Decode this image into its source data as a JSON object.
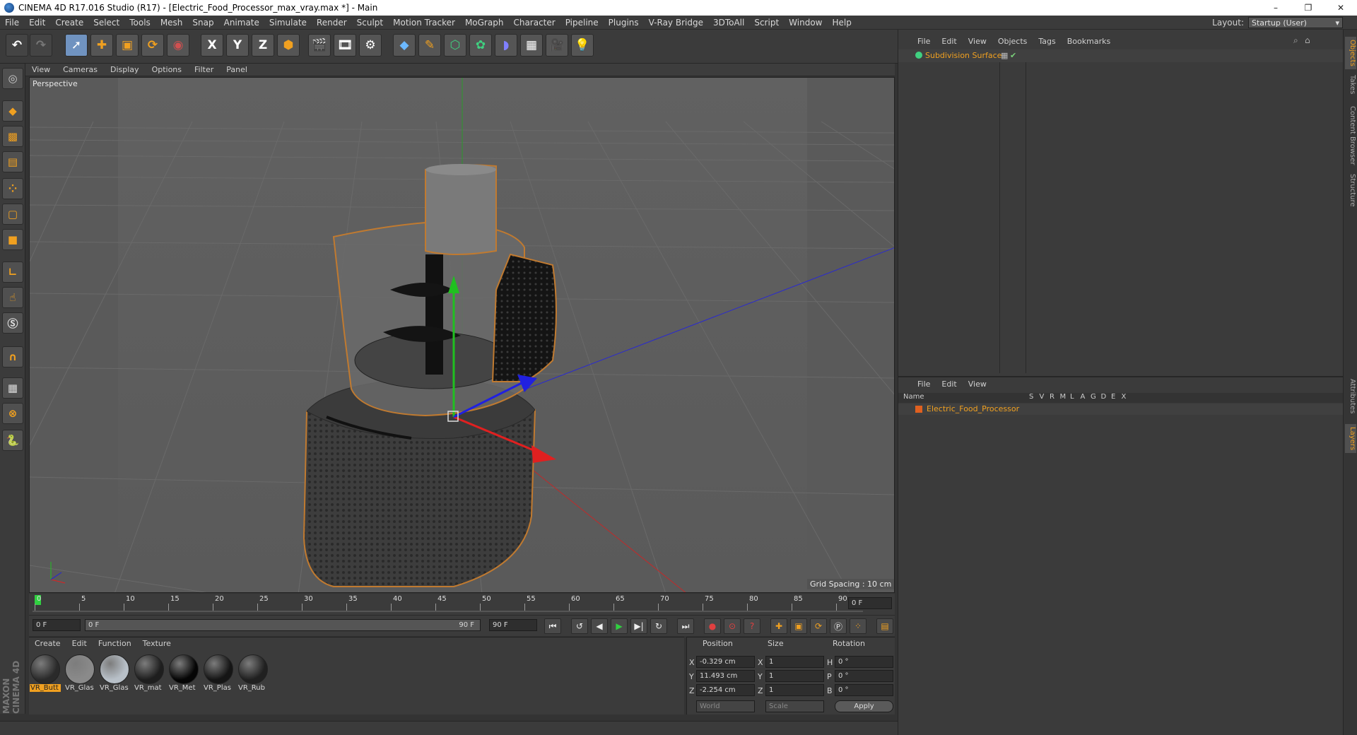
{
  "window": {
    "title": "CINEMA 4D R17.016 Studio (R17) - [Electric_Food_Processor_max_vray.max *] - Main",
    "controls": [
      "–",
      "❐",
      "✕"
    ]
  },
  "menubar": {
    "items": [
      "File",
      "Edit",
      "Create",
      "Select",
      "Tools",
      "Mesh",
      "Snap",
      "Animate",
      "Simulate",
      "Render",
      "Sculpt",
      "Motion Tracker",
      "MoGraph",
      "Character",
      "Pipeline",
      "Plugins",
      "V-Ray Bridge",
      "3DToAll",
      "Script",
      "Window",
      "Help"
    ],
    "layout_label": "Layout:",
    "layout_value": "Startup (User)"
  },
  "toolbar": {
    "axis_x": "X",
    "axis_y": "Y",
    "axis_z": "Z"
  },
  "viewport": {
    "menu": [
      "View",
      "Cameras",
      "Display",
      "Options",
      "Filter",
      "Panel"
    ],
    "label": "Perspective",
    "grid_spacing": "Grid Spacing : 10 cm"
  },
  "timeline": {
    "ticks": [
      "0",
      "5",
      "10",
      "15",
      "20",
      "25",
      "30",
      "35",
      "40",
      "45",
      "50",
      "55",
      "60",
      "65",
      "70",
      "75",
      "80",
      "85",
      "90"
    ],
    "current_frame": "0 F",
    "start_field": "0 F",
    "range_start": "0 F",
    "range_end": "90 F",
    "end_field": "90 F"
  },
  "material_manager": {
    "menu": [
      "Create",
      "Edit",
      "Function",
      "Texture"
    ],
    "materials": [
      {
        "name": "VR_Butt",
        "color": "#2a2a2a"
      },
      {
        "name": "VR_Glas",
        "color": "#8a8a8a"
      },
      {
        "name": "VR_Glas",
        "color": "#b8c0c8"
      },
      {
        "name": "VR_mat",
        "color": "#1e1e1e"
      },
      {
        "name": "VR_Met",
        "color": "#050505"
      },
      {
        "name": "VR_Plas",
        "color": "#151515"
      },
      {
        "name": "VR_Rub",
        "color": "#202020"
      }
    ]
  },
  "coordinates": {
    "headers": {
      "position": "Position",
      "size": "Size",
      "rotation": "Rotation"
    },
    "rows": [
      {
        "axis": "X",
        "pos": "-0.329 cm",
        "size_axis": "X",
        "size": "1",
        "rot_axis": "H",
        "rot": "0 °"
      },
      {
        "axis": "Y",
        "pos": "11.493 cm",
        "size_axis": "Y",
        "size": "1",
        "rot_axis": "P",
        "rot": "0 °"
      },
      {
        "axis": "Z",
        "pos": "-2.254 cm",
        "size_axis": "Z",
        "size": "1",
        "rot_axis": "B",
        "rot": "0 °"
      }
    ],
    "mode": "World",
    "size_mode": "Scale",
    "apply": "Apply"
  },
  "object_manager": {
    "menu": [
      "File",
      "Edit",
      "View",
      "Objects",
      "Tags",
      "Bookmarks"
    ],
    "objects": [
      {
        "name": "Subdivision Surface"
      }
    ]
  },
  "layer_manager": {
    "menu": [
      "File",
      "Edit",
      "View"
    ],
    "columns": [
      "Name",
      "S",
      "V",
      "R",
      "M",
      "L",
      "A",
      "G",
      "D",
      "E",
      "X"
    ],
    "layers": [
      {
        "name": "Electric_Food_Processor"
      }
    ]
  },
  "side_tabs": [
    "Objects",
    "Takes",
    "Content Browser",
    "Structure",
    "Attributes",
    "Layers"
  ],
  "brand": "MAXON CINEMA 4D",
  "colors": {
    "accent": "#f0a020",
    "selection": "#7093c0",
    "ui_bg": "#3b3b3b"
  }
}
